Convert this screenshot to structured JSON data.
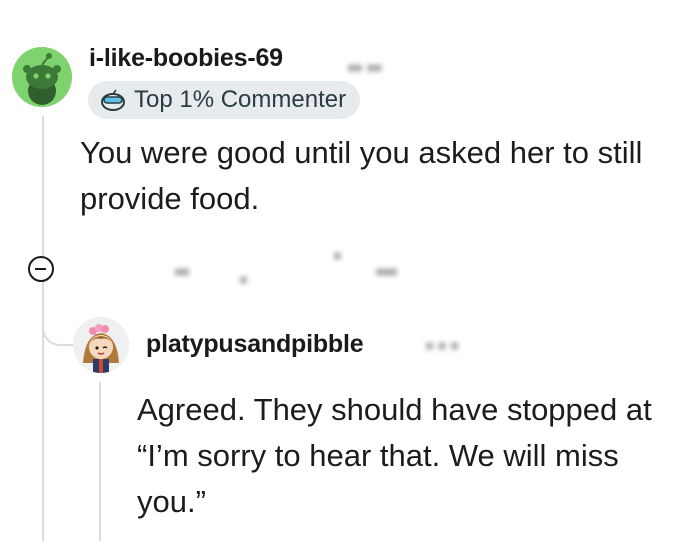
{
  "comment": {
    "author": "i-like-boobies-69",
    "author_meta_blurred": "•• ••",
    "flair": "Top 1% Commenter",
    "body": "You were good until you asked her to still provide food.",
    "actions_blurred": [
      "••",
      "•",
      "•",
      "•••"
    ]
  },
  "reply": {
    "author": "platypusandpibble",
    "author_meta_blurred": "• • •",
    "body": "Agreed. They should have stopped at “I’m sorry to hear that. We will miss you.”"
  },
  "icons": {
    "collapse": "collapse-minus-icon",
    "flair": "snoo-goggles-icon",
    "avatar_main": "snoo-avatar",
    "avatar_reply": "cartoon-avatar"
  },
  "colors": {
    "avatar_main_bg": "#7fd36e",
    "flair_bg": "#e8ebee",
    "thread_line": "#d8dde1"
  }
}
